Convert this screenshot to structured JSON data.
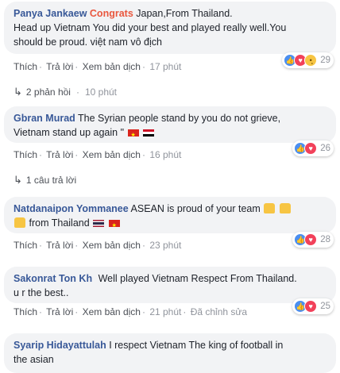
{
  "comments": [
    {
      "author": "Panya Jankaew",
      "highlight": "Congrats",
      "lines": [
        "Japan,From Thailand.",
        "Head up Vietnam You did your best and played really well.You",
        "should be proud. việt nam vô địch"
      ],
      "actions": {
        "like": "Thích",
        "reply": "Trả lời",
        "translate": "Xem bản dịch",
        "time": "17 phút"
      },
      "reaction_count": "29",
      "reaction_icons": [
        "like-icon",
        "love-icon",
        "sad-icon"
      ],
      "replies_label": "2 phản hồi",
      "replies_time": "10 phút"
    },
    {
      "author": "Gbran Murad",
      "lines": [
        "The Syrian people stand by you do not grieve,",
        "Vietnam stand up again \""
      ],
      "actions": {
        "like": "Thích",
        "reply": "Trả lời",
        "translate": "Xem bản dịch",
        "time": "16 phút"
      },
      "reaction_count": "26",
      "reaction_icons": [
        "like-icon",
        "love-icon"
      ],
      "replies_label": "1 câu trả lời"
    },
    {
      "author": "Natdanaipon Yommanee",
      "lines": [
        "ASEAN is proud of your team",
        "from Thailand"
      ],
      "actions": {
        "like": "Thích",
        "reply": "Trả lời",
        "translate": "Xem bản dịch",
        "time": "23 phút"
      },
      "reaction_count": "28",
      "reaction_icons": [
        "like-icon",
        "love-icon"
      ]
    },
    {
      "author": "Sakonrat Ton Kh",
      "lines": [
        "Well played Vietnam Respect From Thailand.",
        "u r the best.."
      ],
      "actions": {
        "like": "Thích",
        "reply": "Trả lời",
        "translate": "Xem bản dịch",
        "time": "21 phút",
        "edited": "Đã chỉnh sửa"
      },
      "reaction_count": "25",
      "reaction_icons": [
        "like-icon",
        "love-icon"
      ]
    },
    {
      "author": "Syarip Hidayattulah",
      "lines": [
        "I respect Vietnam The king of football in",
        "the asian"
      ]
    }
  ],
  "colors": {
    "author": "#385898",
    "congrats": "#e9573e",
    "bubble": "#f2f3f5",
    "meta": "#90949c"
  }
}
